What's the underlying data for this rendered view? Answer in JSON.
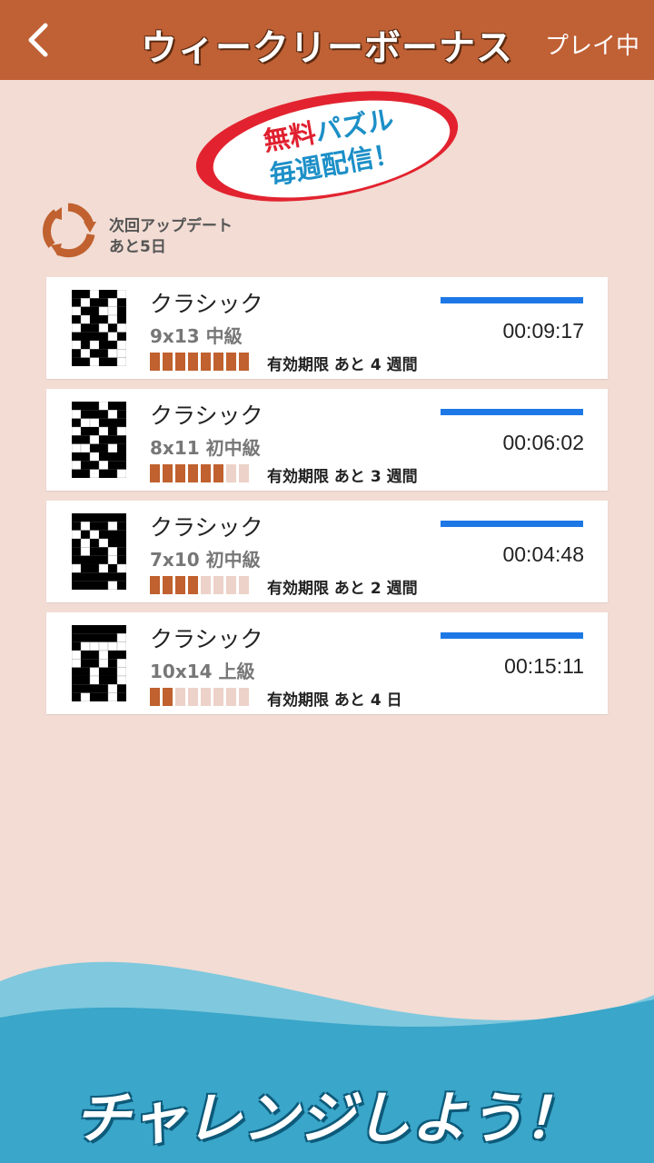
{
  "header": {
    "title": "ウィークリーボーナス",
    "status": "プレイ中",
    "color": "#c06035"
  },
  "promo": {
    "line1_red": "無料",
    "line1_blue": "パズル",
    "line2": "毎週配信！"
  },
  "update": {
    "line1": "次回アップデート",
    "line2": "あと5日",
    "icon": "refresh-icon"
  },
  "puzzles": [
    {
      "title": "クラシック",
      "size_level": "9x13 中級",
      "time": "00:09:17",
      "expiry": "有効期限 あと 4 週間",
      "remaining": 8,
      "total": 8
    },
    {
      "title": "クラシック",
      "size_level": "8x11 初中級",
      "time": "00:06:02",
      "expiry": "有効期限 あと 3 週間",
      "remaining": 6,
      "total": 8
    },
    {
      "title": "クラシック",
      "size_level": "7x10 初中級",
      "time": "00:04:48",
      "expiry": "有効期限 あと 2 週間",
      "remaining": 4,
      "total": 8
    },
    {
      "title": "クラシック",
      "size_level": "10x14 上級",
      "time": "00:15:11",
      "expiry": "有効期限 あと 4 日",
      "remaining": 2,
      "total": 8
    }
  ],
  "footer": {
    "cta": "チャレンジしよう！"
  }
}
